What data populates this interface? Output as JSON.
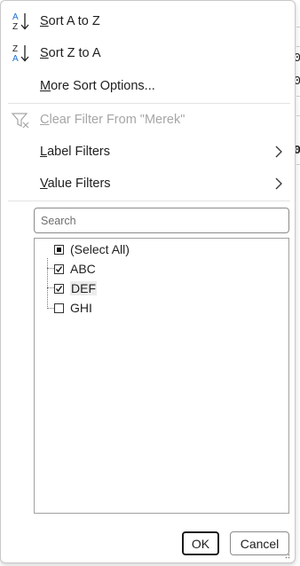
{
  "background_sheet": {
    "fragments": [
      "0",
      "0",
      "0"
    ]
  },
  "menu": {
    "sort_asc": {
      "label_prefix": "S",
      "label_rest": "ort A to Z",
      "icon": "sort-ascending-icon"
    },
    "sort_desc": {
      "label_prefix": "S",
      "label_rest": "ort Z to A",
      "icon": "sort-descending-icon"
    },
    "more_sort": {
      "label_prefix": "M",
      "label_rest": "ore Sort Options..."
    },
    "clear_filter": {
      "label_prefix": "C",
      "label_rest": "lear Filter From \"Merek\"",
      "icon": "clear-filter-icon",
      "disabled": true
    },
    "label_filters": {
      "label_prefix": "L",
      "label_rest": "abel Filters",
      "icon": "chevron-right-icon"
    },
    "value_filters": {
      "label_prefix": "V",
      "label_rest": "alue Filters",
      "icon": "chevron-right-icon"
    }
  },
  "search": {
    "placeholder": "Search",
    "value": ""
  },
  "filter_list": {
    "select_all": {
      "label": "(Select All)",
      "state": "indeterminate"
    },
    "items": [
      {
        "label": "ABC",
        "checked": true
      },
      {
        "label": "DEF",
        "checked": true
      },
      {
        "label": "GHI",
        "checked": false
      }
    ]
  },
  "buttons": {
    "ok": "OK",
    "cancel": "Cancel"
  },
  "colors": {
    "disabled_text": "#a6a6a6",
    "accent_blue": "#1e6fd8",
    "border": "#c8c8c8"
  }
}
